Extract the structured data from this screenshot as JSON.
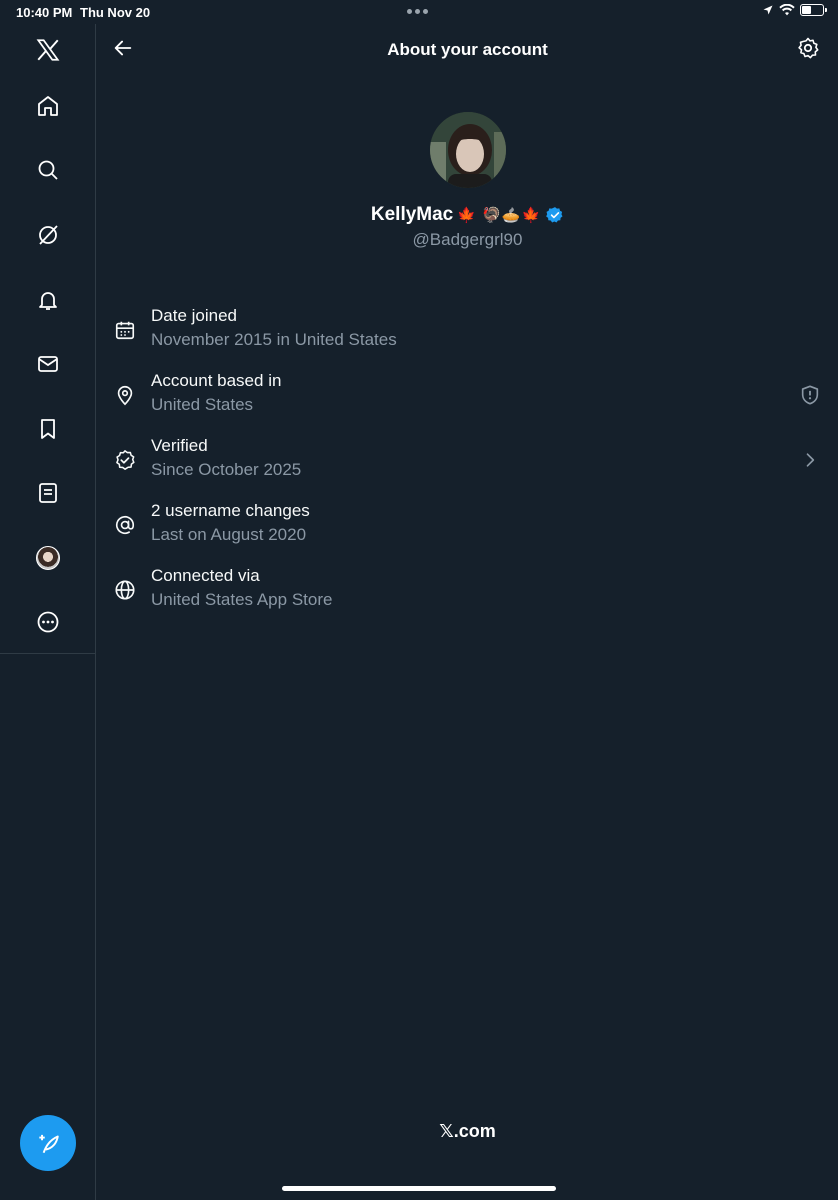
{
  "status_bar": {
    "time": "10:40 PM",
    "date": "Thu Nov 20"
  },
  "sidebar": {
    "items": [
      {
        "icon": "x-logo-icon"
      },
      {
        "icon": "home-icon"
      },
      {
        "icon": "search-icon"
      },
      {
        "icon": "grok-icon"
      },
      {
        "icon": "bell-icon"
      },
      {
        "icon": "mail-icon"
      },
      {
        "icon": "bookmark-icon"
      },
      {
        "icon": "list-icon"
      },
      {
        "icon": "profile-avatar"
      },
      {
        "icon": "more-icon"
      }
    ],
    "compose_icon": "compose-icon"
  },
  "header": {
    "title": "About your account"
  },
  "profile": {
    "display_name": "KellyMac",
    "emojis": "🍁 🦃🥧🍁",
    "handle": "@Badgergrl90",
    "verified": true
  },
  "info": [
    {
      "title": "Date joined",
      "subtitle": "November 2015 in United States",
      "icon": "calendar-icon"
    },
    {
      "title": "Account based in",
      "subtitle": "United States",
      "icon": "location-pin-icon",
      "right_icon": "shield-alert-icon"
    },
    {
      "title": "Verified",
      "subtitle": "Since October 2025",
      "icon": "verified-check-icon",
      "right_icon": "chevron-right-icon"
    },
    {
      "title": "2 username changes",
      "subtitle": "Last on August 2020",
      "icon": "at-sign-icon"
    },
    {
      "title": "Connected via",
      "subtitle": "United States App Store",
      "icon": "globe-icon"
    }
  ],
  "footer": {
    "brand": "𝕏.com"
  },
  "colors": {
    "background": "#15202b",
    "accent": "#1d9bf0",
    "secondary_text": "#8b98a5",
    "divider": "#2f3b45"
  }
}
